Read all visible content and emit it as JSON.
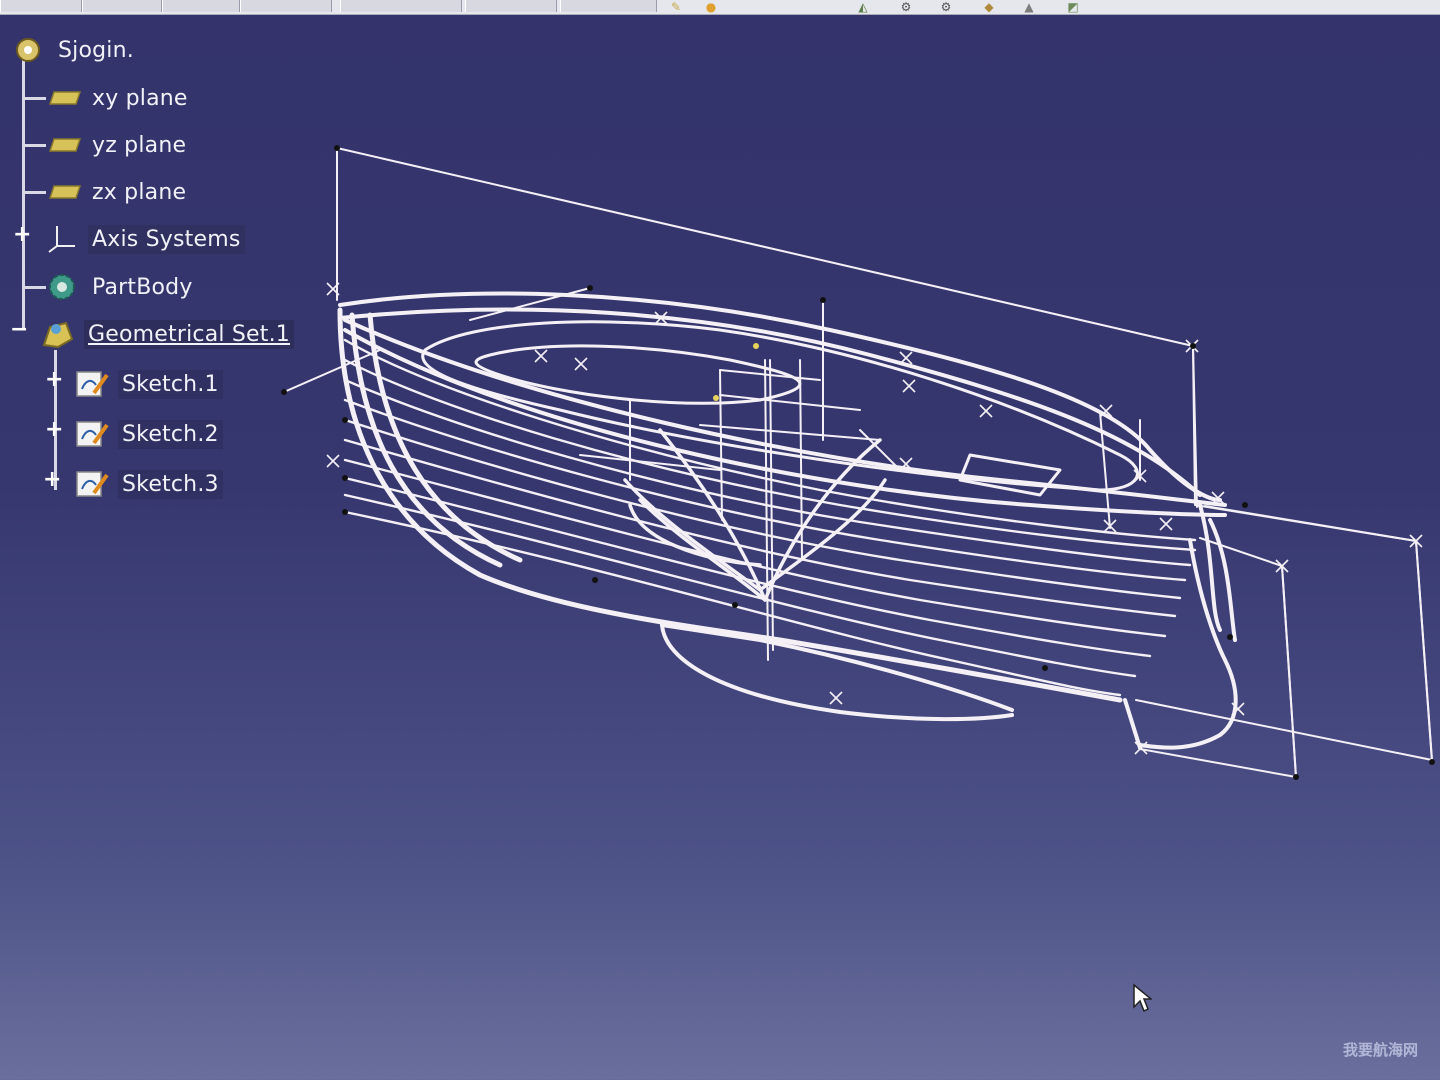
{
  "toolbar": {
    "icons": [
      "sketch-tool-icon",
      "gear-icon",
      "gear-icon",
      "box-icon",
      "cone-icon",
      "surface-icon"
    ]
  },
  "tree": {
    "root": {
      "label": "Sjogin.",
      "icon": "part-icon"
    },
    "items": [
      {
        "label": "xy plane",
        "icon": "plane-icon"
      },
      {
        "label": "yz plane",
        "icon": "plane-icon"
      },
      {
        "label": "zx plane",
        "icon": "plane-icon"
      },
      {
        "label": "Axis Systems",
        "icon": "axis-icon",
        "expander": "+"
      },
      {
        "label": "PartBody",
        "icon": "gear-icon"
      },
      {
        "label": "Geometrical Set.1",
        "icon": "geometrical-set-icon",
        "expander": "−"
      }
    ],
    "children": [
      {
        "label": "Sketch.1",
        "icon": "sketch-icon",
        "expander": "+"
      },
      {
        "label": "Sketch.2",
        "icon": "sketch-icon",
        "expander": "+"
      },
      {
        "label": "Sketch.3",
        "icon": "sketch-icon",
        "expander": "+"
      }
    ]
  },
  "viewport": {
    "background": "#35356d",
    "wire_color": "#f4f0f6",
    "content": "boat-hull-wireframe"
  },
  "watermark": "我要航海网"
}
